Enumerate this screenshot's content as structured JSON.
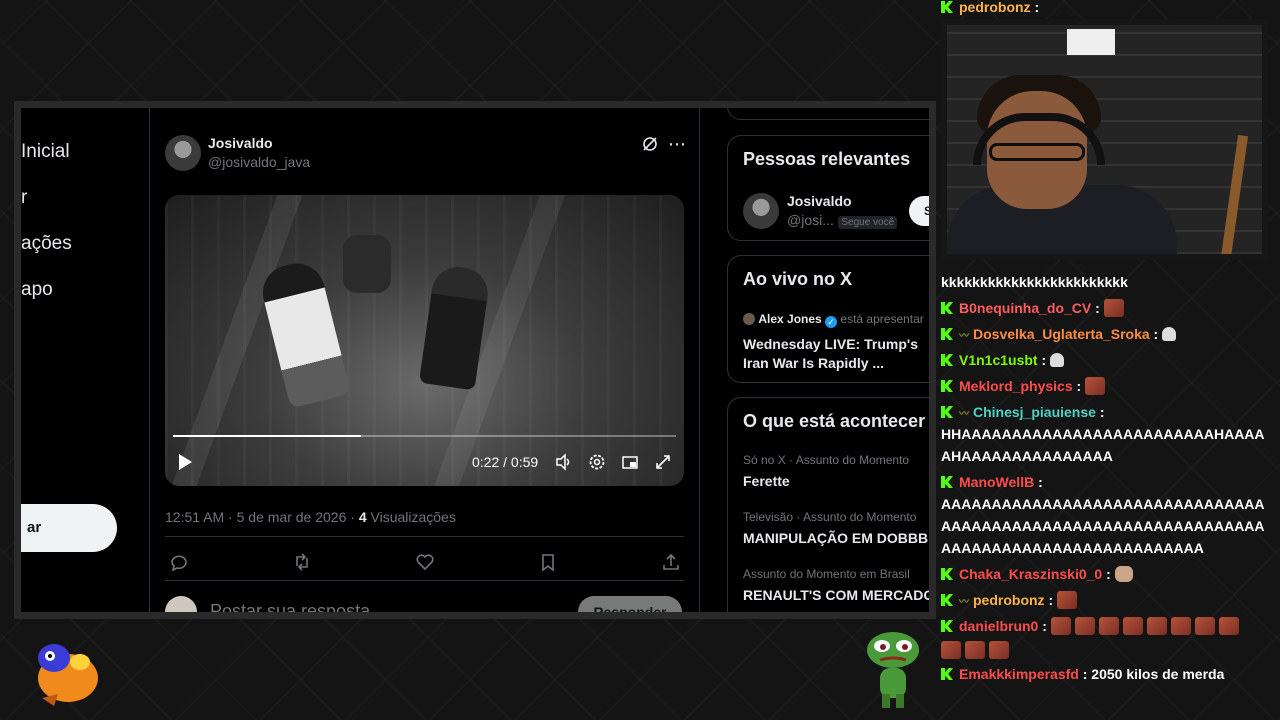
{
  "nav": {
    "items": [
      "Inicial",
      "r",
      "ações",
      "apo"
    ],
    "post_label": "ar"
  },
  "post": {
    "author_name": "Josivaldo",
    "author_handle": "@josivaldo_java",
    "video": {
      "time_current": "0:22",
      "time_sep": "/",
      "time_total": "0:59",
      "progress": 0.373
    },
    "time": "12:51 AM",
    "date": "5 de mar de 2026",
    "views_count": "4",
    "views_label": "Visualizações",
    "reply_placeholder": "Postar sua resposta",
    "reply_button": "Responder"
  },
  "sidebar": {
    "relevant": {
      "title": "Pessoas relevantes",
      "person_name": "Josivaldo",
      "person_handle": "@josi...",
      "follows_badge": "Segue você",
      "follow_button": "S"
    },
    "live": {
      "title": "Ao vivo no X",
      "host": "Alex Jones",
      "host_status": "está apresentar",
      "stream_title": "Wednesday LIVE: Trump's Iran War Is Rapidly ..."
    },
    "trends": {
      "title": "O que está acontecer",
      "items": [
        {
          "context": "Só no X · Assunto do Momento",
          "name": "Ferette"
        },
        {
          "context": "Televisão · Assunto do Momento",
          "name": "MANIPULAÇÃO EM DOBBBR"
        },
        {
          "context": "Assunto do Momento em Brasil",
          "name": "RENAULT'S COM MERCADO"
        }
      ]
    }
  },
  "chat": {
    "top_partial": {
      "user": "pedrobonz",
      "text": ":"
    },
    "spam_line": "kkkkkkkkkkkkkkkkkkkkkkkk",
    "messages": [
      {
        "user": "B0nequinha_do_CV",
        "color": "#ff5c5c",
        "sep": ":",
        "text": ""
      },
      {
        "user": "Dosvelka_Uglaterta_Sroka",
        "color": "#ff8c42",
        "sep": ":",
        "text": ""
      },
      {
        "user": "V1n1c1usbt",
        "color": "#7cfc00",
        "sep": ":",
        "text": ""
      },
      {
        "user": "Meklord_physics",
        "color": "#ff4d4d",
        "sep": ":",
        "text": ""
      },
      {
        "user": "Chinesj_piauiense",
        "color": "#4fd1c5",
        "sep": ":",
        "text": "HHAAAAAAAAAAAAAAAAAAAAAAAAAHAAAAAHAAAAAAAAAAAAAAA"
      },
      {
        "user": "ManoWellB",
        "color": "#ff4d4d",
        "sep": ":",
        "text": "AAAAAAAAAAAAAAAAAAAAAAAAAAAAAAAAAAAAAAAAAAAAAAAAAAAAAAAAAAAAAAAAAAAAAAAAAAAAAAAAAAAAAAAAAA"
      },
      {
        "user": "Chaka_Kraszinski0_0",
        "color": "#ff4d4d",
        "sep": ":",
        "text": ""
      },
      {
        "user": "pedrobonz",
        "color": "#ffb347",
        "sep": ":",
        "text": ""
      },
      {
        "user": "danielbrun0",
        "color": "#ff4d4d",
        "sep": ":",
        "text": ""
      },
      {
        "user": "Emakkkimperasfd",
        "color": "#ff4d4d",
        "sep": ":",
        "text": "2050 kilos de merda"
      }
    ]
  },
  "colors": {
    "accent_kick": "#53fc18",
    "x_bg": "#000000",
    "verified": "#1d9bf0"
  }
}
